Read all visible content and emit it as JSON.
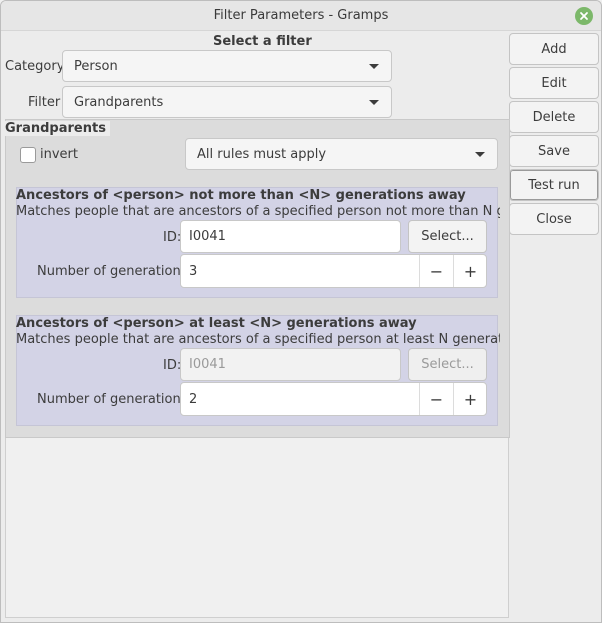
{
  "window": {
    "title": "Filter Parameters - Gramps"
  },
  "header": {
    "select_filter": "Select a filter"
  },
  "category": {
    "label": "Category",
    "value": "Person"
  },
  "filter": {
    "label": "Filter",
    "value": "Grandparents"
  },
  "side_buttons": {
    "add": "Add",
    "edit": "Edit",
    "delete": "Delete",
    "save": "Save",
    "test_run": "Test run",
    "close": "Close"
  },
  "group": {
    "title": "Grandparents",
    "invert_label": "invert",
    "rules_mode": "All rules must apply"
  },
  "rules": [
    {
      "title": "Ancestors of <person> not more than <N> generations away",
      "description": "Matches people that are ancestors of a specified person not more than N gener...",
      "id_label": "ID:",
      "id_value": "I0041",
      "select_label": "Select...",
      "gen_label": "Number of generations:",
      "gen_value": "3"
    },
    {
      "title": "Ancestors of <person> at least <N> generations away",
      "description": "Matches people that are ancestors of a specified person at least N generation...",
      "id_label": "ID:",
      "id_value": "I0041",
      "select_label": "Select...",
      "gen_label": "Number of generations:",
      "gen_value": "2"
    }
  ],
  "spin": {
    "minus": "−",
    "plus": "+"
  },
  "icons": {
    "close": "close-icon",
    "dropdown": "chevron-down-icon"
  }
}
